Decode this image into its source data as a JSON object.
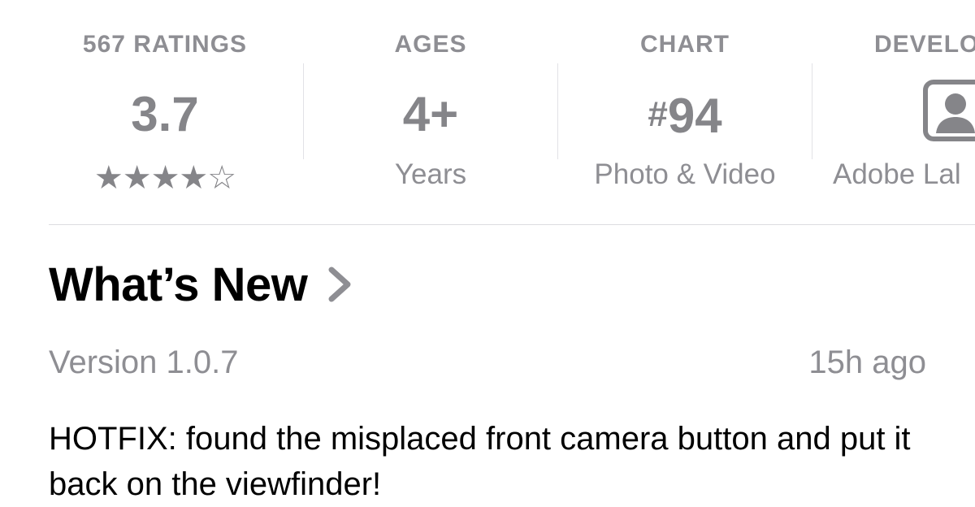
{
  "info": {
    "ratings": {
      "header": "567 RATINGS",
      "value": "3.7",
      "stars": "★★★★☆",
      "star_rating": 3.7,
      "star_max": 5
    },
    "ages": {
      "header": "AGES",
      "value": "4+",
      "sub": "Years"
    },
    "chart": {
      "header": "CHART",
      "hash": "#",
      "value": "94",
      "sub": "Photo & Video"
    },
    "developer": {
      "header": "DEVELO",
      "sub": "Adobe Lal",
      "icon": "person-square-icon"
    }
  },
  "whats_new": {
    "title": "What’s New",
    "chevron_icon": "chevron-right-icon",
    "version": "Version 1.0.7",
    "time_ago": "15h ago",
    "notes": "HOTFIX: found the misplaced front camera button and put it back on the viewfinder!"
  },
  "colors": {
    "secondary_text": "#8e8e93",
    "primary_text": "#000000",
    "divider": "#dcdce0",
    "background": "#ffffff"
  }
}
